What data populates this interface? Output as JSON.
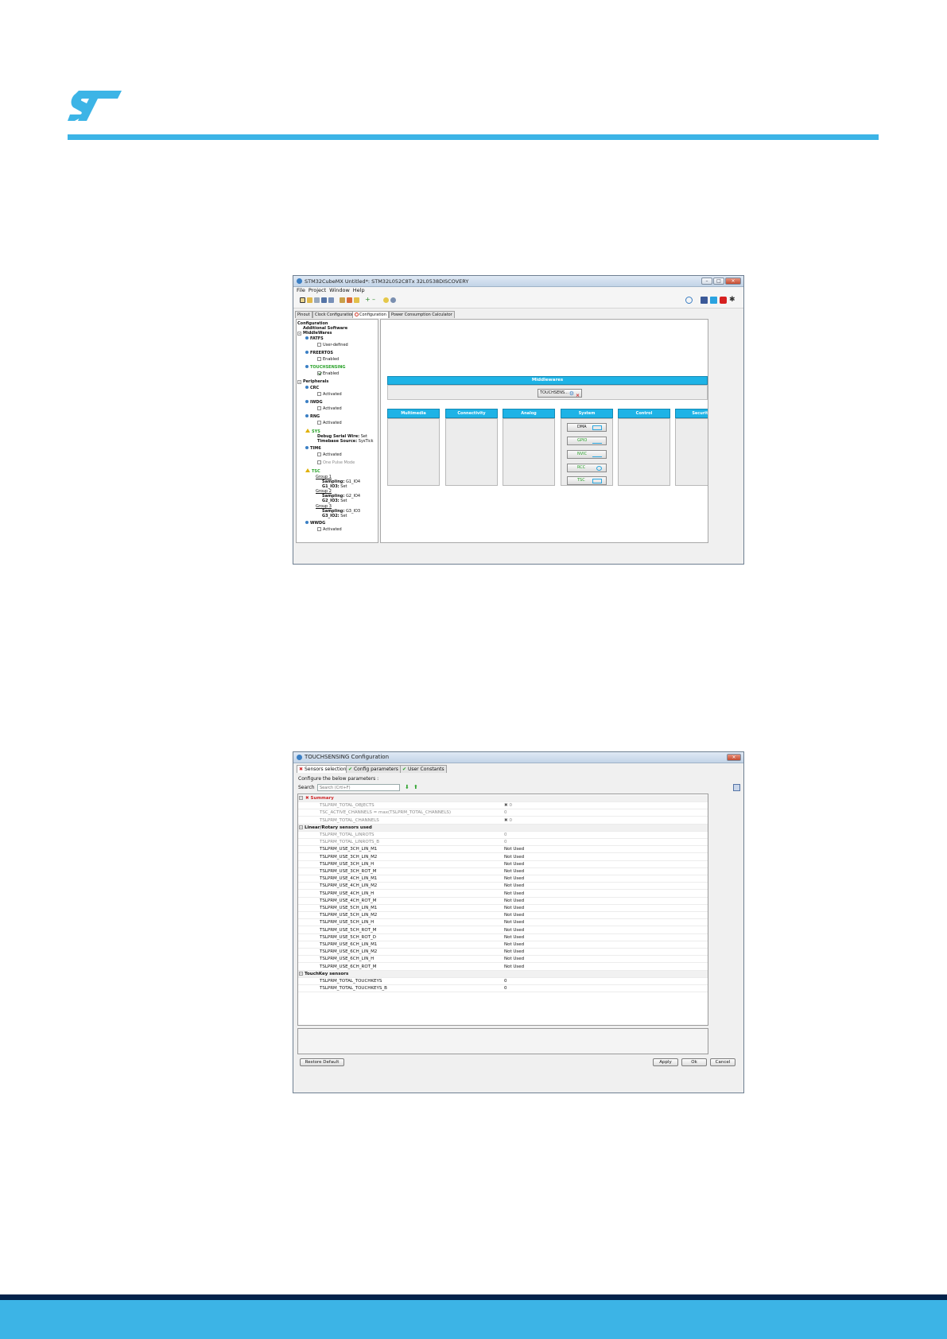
{
  "colors": {
    "brand": "#03234b",
    "accent": "#3cb4e6",
    "panel_header": "#1eb3e6",
    "warning": "#d0282a",
    "ok": "#2aa22a"
  },
  "window1": {
    "title": "STM32CubeMX Untitled*: STM32L052C8Tx 32L0538DISCOVERY",
    "menu": [
      "File",
      "Project",
      "Window",
      "Help"
    ],
    "window_controls": [
      "minimize-icon",
      "maximize-icon",
      "close-icon"
    ],
    "toolbar_icons": [
      "new-project-icon",
      "open-icon",
      "load-icon",
      "save-icon",
      "save-as-icon",
      "import-icon",
      "generate-report-icon",
      "generate-code-icon",
      "zoom-in-icon",
      "zoom-out-icon",
      "help-icon",
      "about-icon"
    ],
    "social_icons": [
      "update-icon",
      "facebook-icon",
      "twitter-icon",
      "youtube-icon",
      "st-community-icon"
    ],
    "tabs": [
      "Pinout",
      "Clock Configuration",
      "Configuration",
      "Power Consumption Calculator"
    ],
    "tree": {
      "root": "Configuration",
      "additional": "Additional Software",
      "middlewares": "MiddleWares",
      "fatfs": "FATFS",
      "fatfs_opt": "User-defined",
      "freertos": "FREERTOS",
      "freertos_opt": "Enabled",
      "touchsensing": "TOUCHSENSING",
      "touchsensing_opt": "Enabled",
      "peripherals": "Peripherals",
      "crc": "CRC",
      "crc_opt": "Activated",
      "iwdg": "IWDG",
      "iwdg_opt": "Activated",
      "rng": "RNG",
      "rng_opt": "Activated",
      "sys": "SYS",
      "sys_l1": "Debug Serial Wire:",
      "sys_v1": "Set",
      "sys_l2": "Timebase Source:",
      "sys_v2": "SysTick",
      "tim6": "TIM6",
      "tim6_opt1": "Activated",
      "tim6_opt2": "One Pulse Mode",
      "tsc": "TSC",
      "g1": "Group 1",
      "g1_l1": "Sampling:",
      "g1_v1": "G1_IO4",
      "g1_l2": "G1_IO3:",
      "g1_v2": "Set",
      "g2": "Group 2",
      "g2_l1": "Sampling:",
      "g2_v1": "G2_IO4",
      "g2_l2": "G2_IO3:",
      "g2_v2": "Set",
      "g3": "Group 3",
      "g3_l1": "Sampling:",
      "g3_v1": "G3_IO3",
      "g3_l2": "G3_IO2:",
      "g3_v2": "Set",
      "wwdg": "WWDG",
      "wwdg_opt": "Activated"
    },
    "middlewares_title": "Middlewares",
    "middlewares_button": "TOUCHSENS...",
    "categories": [
      "Multimedia",
      "Connectivity",
      "Analog",
      "System",
      "Control",
      "Security"
    ],
    "system_buttons": [
      "DMA",
      "GPIO",
      "NVIC",
      "RCC",
      "TSC"
    ]
  },
  "window2": {
    "title": "TOUCHSENSING Configuration",
    "tabs": [
      "Sensors selection",
      "Config parameters",
      "User Constants"
    ],
    "instruction": "Configure the below parameters :",
    "search_label": "Search",
    "search_placeholder": "Search (Crtl+F)",
    "groups": [
      {
        "name": "Summary",
        "rows": [
          {
            "name": "TSLPRM_TOTAL_OBJECTS",
            "value": "0",
            "grey": true,
            "x": true
          },
          {
            "name": "TSC_ACTIVE_CHANNELS = max(TSLPRM_TOTAL_CHANNELS)",
            "value": "0",
            "grey": true,
            "x": false
          },
          {
            "name": "TSLPRM_TOTAL_CHANNELS",
            "value": "0",
            "grey": true,
            "x": true
          }
        ]
      },
      {
        "name": "Linear/Rotary sensors used",
        "rows": [
          {
            "name": "TSLPRM_TOTAL_LINROTS",
            "value": "0",
            "grey": true
          },
          {
            "name": "TSLPRM_TOTAL_LINROTS_B",
            "value": "0",
            "grey": true
          },
          {
            "name": "TSLPRM_USE_3CH_LIN_M1",
            "value": "Not Used"
          },
          {
            "name": "TSLPRM_USE_3CH_LIN_M2",
            "value": "Not Used"
          },
          {
            "name": "TSLPRM_USE_3CH_LIN_H",
            "value": "Not Used"
          },
          {
            "name": "TSLPRM_USE_3CH_ROT_M",
            "value": "Not Used"
          },
          {
            "name": "TSLPRM_USE_4CH_LIN_M1",
            "value": "Not Used"
          },
          {
            "name": "TSLPRM_USE_4CH_LIN_M2",
            "value": "Not Used"
          },
          {
            "name": "TSLPRM_USE_4CH_LIN_H",
            "value": "Not Used"
          },
          {
            "name": "TSLPRM_USE_4CH_ROT_M",
            "value": "Not Used"
          },
          {
            "name": "TSLPRM_USE_5CH_LIN_M1",
            "value": "Not Used"
          },
          {
            "name": "TSLPRM_USE_5CH_LIN_M2",
            "value": "Not Used"
          },
          {
            "name": "TSLPRM_USE_5CH_LIN_H",
            "value": "Not Used"
          },
          {
            "name": "TSLPRM_USE_5CH_ROT_M",
            "value": "Not Used"
          },
          {
            "name": "TSLPRM_USE_5CH_ROT_D",
            "value": "Not Used"
          },
          {
            "name": "TSLPRM_USE_6CH_LIN_M1",
            "value": "Not Used"
          },
          {
            "name": "TSLPRM_USE_6CH_LIN_M2",
            "value": "Not Used"
          },
          {
            "name": "TSLPRM_USE_6CH_LIN_H",
            "value": "Not Used"
          },
          {
            "name": "TSLPRM_USE_6CH_ROT_M",
            "value": "Not Used"
          }
        ]
      },
      {
        "name": "TouchKey sensors",
        "rows": [
          {
            "name": "TSLPRM_TOTAL_TOUCHKEYS",
            "value": "0"
          },
          {
            "name": "TSLPRM_TOTAL_TOUCHKEYS_B",
            "value": "0"
          }
        ]
      }
    ],
    "buttons": {
      "restore": "Restore Default",
      "apply": "Apply",
      "ok": "Ok",
      "cancel": "Cancel"
    }
  }
}
